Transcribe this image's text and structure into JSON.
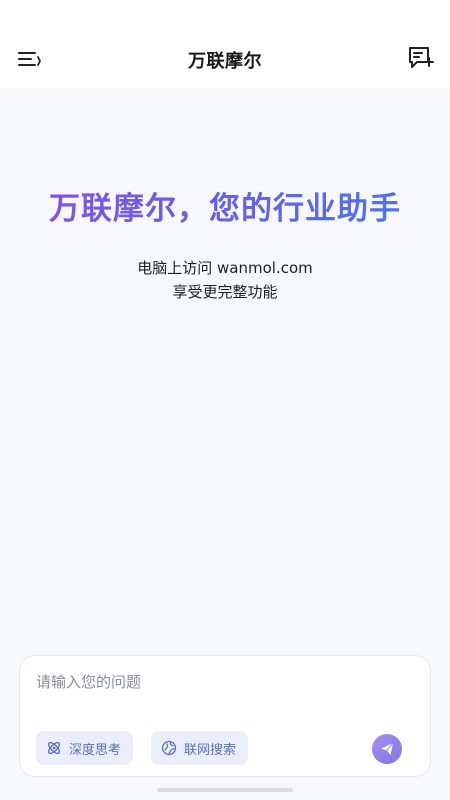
{
  "header": {
    "title": "万联摩尔",
    "menu_icon": "menu-collapse-icon",
    "new_chat_icon": "new-chat-icon"
  },
  "hero": {
    "title": "万联摩尔，您的行业助手",
    "line1": "电脑上访问 wanmol.com",
    "line2": "享受更完整功能",
    "gradient_colors": [
      "#8a4fe6",
      "#4a76ee"
    ]
  },
  "composer": {
    "placeholder": "请输入您的问题",
    "value": "",
    "chips": [
      {
        "label": "深度思考",
        "icon": "atom-icon"
      },
      {
        "label": "联网搜索",
        "icon": "globe-icon"
      }
    ],
    "send_icon": "paper-plane-icon",
    "accent_color": "#8b7fe8"
  }
}
